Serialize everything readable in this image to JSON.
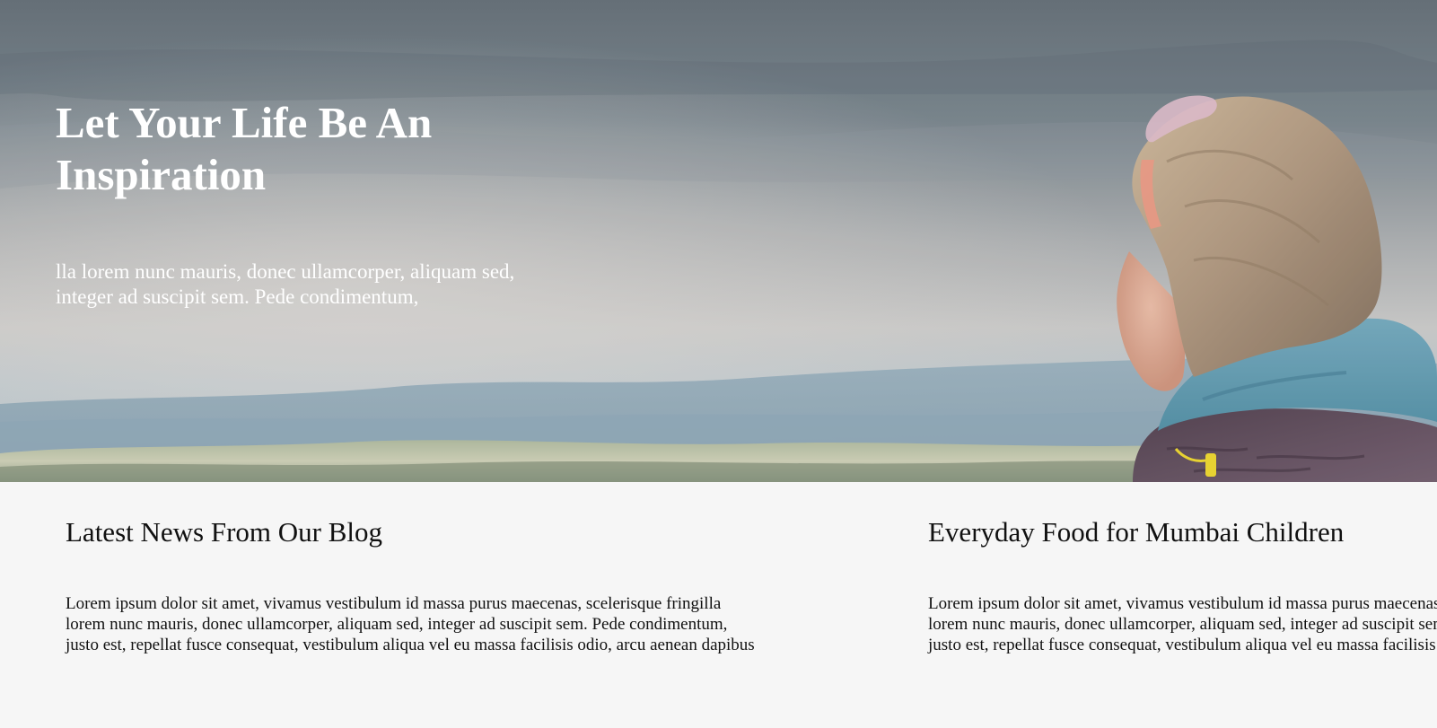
{
  "hero": {
    "title": "Let Your Life Be An Inspiration",
    "text_lines": [
      "lla lorem nunc mauris, donec ullamcorper, aliquam sed,",
      "integer ad suscipit sem. Pede condimentum,"
    ],
    "image": "woman-overlooking-mountains-photo"
  },
  "blog": {
    "posts": [
      {
        "title": "Latest News From Our Blog",
        "lines": [
          "Lorem ipsum dolor sit amet, vivamus vestibulum id massa purus maecenas, scelerisque fringilla",
          "lorem nunc mauris, donec ullamcorper, aliquam sed, integer ad suscipit sem. Pede condimentum,",
          "justo est, repellat fusce consequat, vestibulum aliqua vel eu massa facilisis odio, arcu aenean dapibus"
        ]
      },
      {
        "title": "Everyday Food for Mumbai Children",
        "lines": [
          "Lorem ipsum dolor sit amet, vivamus vestibulum id massa purus maecenas, scelerisque fringilla",
          "lorem nunc mauris, donec ullamcorper, aliquam sed, integer ad suscipit sem. Pede condimentum,",
          "justo est, repellat fusce consequat, vestibulum aliqua vel eu massa facilisis odio, arcu aenean dapibus"
        ]
      }
    ]
  },
  "colors": {
    "hero_text": "#ffffff",
    "blog_background": "#f6f6f6",
    "body_text": "#111111"
  }
}
